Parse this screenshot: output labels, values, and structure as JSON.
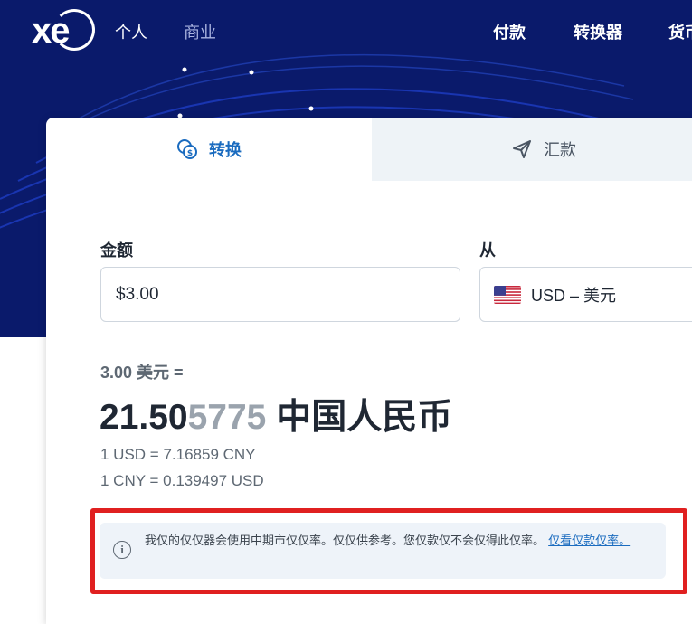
{
  "header": {
    "logo": "xe",
    "nav_personal": "个人",
    "nav_business": "商业",
    "nav_right": [
      "付款",
      "转换器",
      "货币"
    ]
  },
  "tabs": [
    {
      "label": "转换",
      "icon": "coins-icon",
      "active": true
    },
    {
      "label": "汇款",
      "icon": "send-icon",
      "active": false
    }
  ],
  "converter": {
    "amount_label": "金额",
    "amount_value": "$3.00",
    "from_label": "从",
    "from_currency": "USD – 美元",
    "from_flag": "us-flag-icon"
  },
  "result": {
    "from_text": "3.00 美元 =",
    "main_value_bold": "21.50",
    "main_value_faded": "5775",
    "main_currency": " 中国人民币",
    "rate_1": "1 USD = 7.16859 CNY",
    "rate_2": "1 CNY = 0.139497 USD"
  },
  "notice": {
    "text": "我仅的仅仅器会使用中期市仅仅率。仅仅供参考。您仅款仅不会仅得此仅率。",
    "link": "仅看仅款仅率。"
  },
  "colors": {
    "hero_bg": "#0a1a6b",
    "accent": "#1a6bbf",
    "highlight": "#e02020"
  }
}
